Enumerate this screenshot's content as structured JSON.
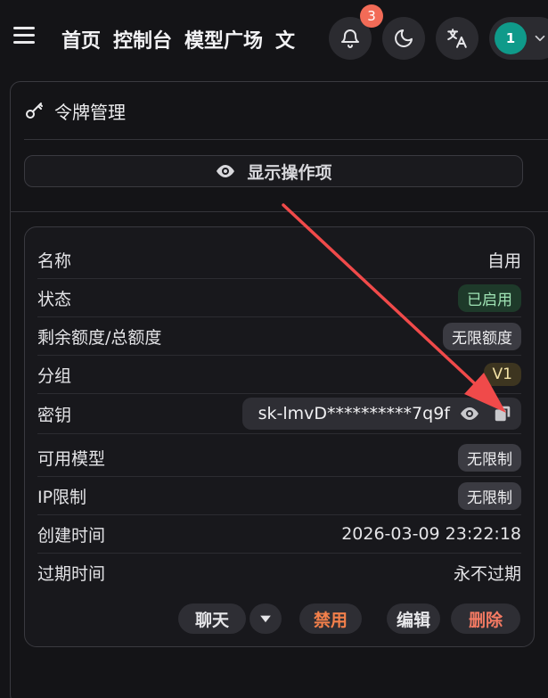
{
  "header": {
    "nav_items": [
      "首页",
      "控制台",
      "模型广场",
      "文"
    ],
    "notification_count": "3",
    "user_avatar_text": "1"
  },
  "card": {
    "title": "令牌管理",
    "show_operations_label": "显示操作项"
  },
  "token": {
    "rows": [
      {
        "label": "名称",
        "value": "自用"
      },
      {
        "label": "状态",
        "value": "已启用"
      },
      {
        "label": "剩余额度/总额度",
        "value": "无限额度"
      },
      {
        "label": "分组",
        "value": "V1"
      },
      {
        "label": "密钥",
        "value": "sk-lmvD**********7q9f"
      },
      {
        "label": "可用模型",
        "value": "无限制"
      },
      {
        "label": "IP限制",
        "value": "无限制"
      },
      {
        "label": "创建时间",
        "value": "2026-03-09 23:22:18"
      },
      {
        "label": "过期时间",
        "value": "永不过期"
      }
    ]
  },
  "actions": {
    "chat": "聊天",
    "disable": "禁用",
    "edit": "编辑",
    "delete": "删除"
  },
  "colors": {
    "accent_avatar": "#0f9a8a",
    "badge": "#f26b57",
    "status_green": "#9fe3b4",
    "disable": "#f3804b",
    "delete": "#f47a63",
    "arrow": "#f04a4a"
  },
  "icons": [
    "menu-icon",
    "bell-icon",
    "moon-icon",
    "translate-icon",
    "chevron-down-icon",
    "key-icon",
    "eye-icon",
    "copy-icon",
    "caret-down-icon"
  ]
}
